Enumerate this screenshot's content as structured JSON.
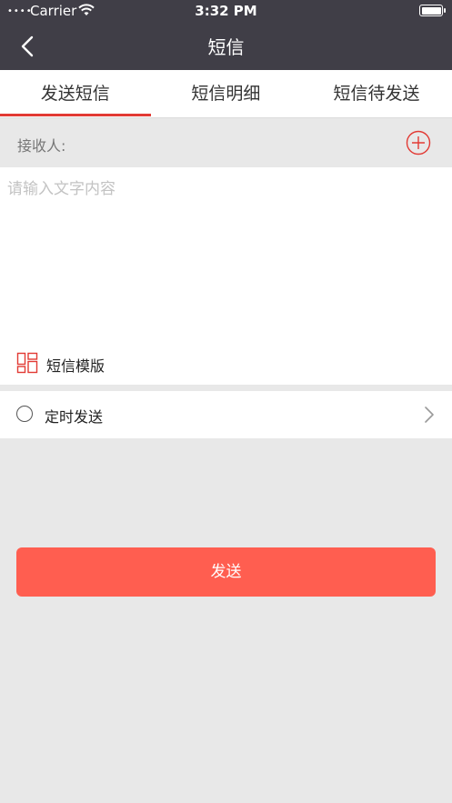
{
  "status_bar": {
    "signal": "••••",
    "carrier": "Carrier",
    "time": "3:32 PM"
  },
  "header": {
    "title": "短信"
  },
  "tabs": [
    {
      "label": "发送短信",
      "active": true
    },
    {
      "label": "短信明细",
      "active": false
    },
    {
      "label": "短信待发送",
      "active": false
    }
  ],
  "recipient": {
    "label": "接收人:"
  },
  "message": {
    "placeholder": "请输入文字内容",
    "value": ""
  },
  "template": {
    "label": "短信模版"
  },
  "schedule": {
    "label": "定时发送",
    "checked": false
  },
  "send_button": {
    "label": "发送"
  },
  "colors": {
    "header_bg": "#403e47",
    "accent": "#e23a34",
    "send_button": "#ff5e50",
    "background": "#e8e8e8"
  }
}
